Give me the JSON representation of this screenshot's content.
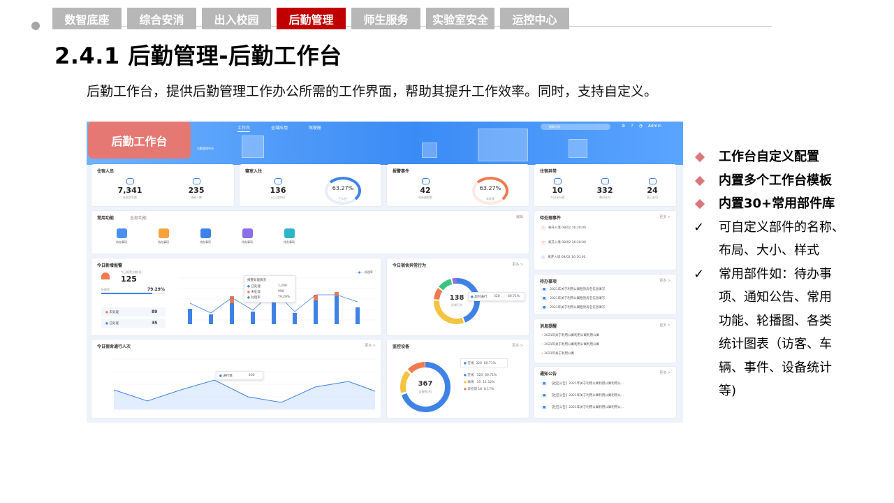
{
  "nav": {
    "tabs": [
      "数智底座",
      "综合安消",
      "出入校园",
      "后勤管理",
      "师生服务",
      "实验室安全",
      "运控中心"
    ],
    "active_index": 3,
    "active_color": "#c00000"
  },
  "title": "2.4.1 后勤管理-后勤工作台",
  "description": "后勤工作台，提供后勤管理工作办公所需的工作界面，帮助其提升工作效率。同时，支持自定义。",
  "screenshot": {
    "badge": "后勤工作台",
    "topnav": [
      "工作台",
      "全域应用",
      "驾驶舱"
    ],
    "search_placeholder": "搜索应用",
    "user": "Admin",
    "subtitle": "后勤管理中台",
    "cards": {
      "residents": {
        "title": "住宿人员",
        "stats": [
          {
            "num": "7,341",
            "label": "住宿学生数"
          },
          {
            "num": "235",
            "label": "请假人数"
          }
        ]
      },
      "checkin": {
        "title": "寝室入住",
        "stats": [
          {
            "num": "136",
            "label": "已入住房间"
          }
        ],
        "ring": "63.27",
        "ring_label": "已入住"
      },
      "alarm": {
        "title": "报警事件",
        "stats": [
          {
            "num": "42",
            "label": "未处理报警"
          }
        ],
        "ring": "63.27",
        "ring_label": "未处理"
      },
      "abnormal": {
        "title": "住宿异常",
        "stats": [
          {
            "num": "10",
            "label": "今日未归寝"
          },
          {
            "num": "332",
            "label": "晚归未归"
          },
          {
            "num": "24",
            "label": "多日未归"
          }
        ]
      },
      "functions": {
        "title": "常用功能",
        "tab2": "全部功能",
        "edit": "编辑",
        "items": [
          "待办事项",
          "待办事项",
          "待办事项",
          "待办事项",
          "待办事项"
        ]
      },
      "todo_events": {
        "title": "待处理事件",
        "more": "更多 >",
        "rows": [
          "离开入境 08/02 16:30:00",
          "离开入境 08/02 16:30:00",
          "离开入境 08/02 16:30:00"
        ]
      },
      "new_alarm": {
        "title": "今日新增报警",
        "sub": "今日报警总数(条)",
        "total": "125",
        "rate_label": "处理率",
        "rate": "79.29%",
        "unhandled_label": "未处理",
        "unhandled": "89",
        "handled_label": "已处理",
        "handled": "35",
        "legend": "处理率",
        "tooltip": {
          "title": "报警处理情况",
          "rows": [
            [
              "已处理",
              "1,200"
            ],
            [
              "未处理",
              "990"
            ],
            [
              "处理率",
              "79.29%"
            ]
          ]
        }
      },
      "dorm_behavior": {
        "title": "今日宿舍异常行为",
        "more": "更多 >",
        "center_num": "138",
        "center_label": "异常行为",
        "tip": "超时通行",
        "tip_num": "320",
        "tip_pct": "60.71%"
      },
      "todo": {
        "title": "待办事项",
        "more": "更多 >",
        "rows": [
          "2021年关于利用公寓租赁房名信息填写",
          "2021年关于利用公寓租赁房名信息填写",
          "2021年关于利用公寓租赁房名信息填写"
        ]
      },
      "messages": {
        "title": "消息提醒",
        "more": "更多 >",
        "rows": [
          "2021年关于利用公寓利用公寓利用公寓",
          "2021年关于利用公寓利用公寓利用公寓",
          "2021年关于利用公寓"
        ]
      },
      "traffic": {
        "title": "今日宿舍通行人次",
        "more": "更多 >",
        "tooltip_label": "通行数",
        "tooltip_value": "400"
      },
      "monitor": {
        "title": "监控设备",
        "more": "更多 >",
        "center_num": "367",
        "center_label": "设备数(台)",
        "legend": [
          [
            "在线",
            "320",
            "60.71%"
          ],
          [
            "离线",
            "35",
            "11.12%"
          ],
          [
            "未检测",
            "18",
            "8.17%"
          ]
        ]
      },
      "notice": {
        "title": "通知公告",
        "more": "更多 >",
        "rows": [
          "【社区公告】2021年关于利用公寓利用公寓利用公...",
          "【社区公告】2021年关于利用公寓利用公寓利用公...",
          "【社区公告】2021年关于利用公寓利用公寓利用公..."
        ]
      }
    }
  },
  "bullets": [
    {
      "marker": "diamond",
      "text": "工作台自定义配置",
      "bold": true
    },
    {
      "marker": "diamond",
      "text": "内置多个工作台模板",
      "bold": true
    },
    {
      "marker": "diamond",
      "text": "内置30+常用部件库",
      "bold": true
    },
    {
      "marker": "check",
      "text": "可自定义部件的名称、"
    },
    {
      "marker": "none",
      "text": "布局、大小、样式"
    },
    {
      "marker": "check",
      "text": "常用部件如：待办事"
    },
    {
      "marker": "none",
      "text": "项、通知公告、常用"
    },
    {
      "marker": "none",
      "text": "功能、轮播图、各类"
    },
    {
      "marker": "none",
      "text": "统计图表（访客、车"
    },
    {
      "marker": "none",
      "text": "辆、事件、设备统计"
    },
    {
      "marker": "none",
      "text": "等)"
    }
  ],
  "check_glyph": "✓",
  "colors": {
    "accent": "#c00000",
    "tab_gray": "#b7b7b7",
    "badge": "#e57873",
    "diamond": "#d9777d",
    "chart_blue": "#3f82e6"
  }
}
